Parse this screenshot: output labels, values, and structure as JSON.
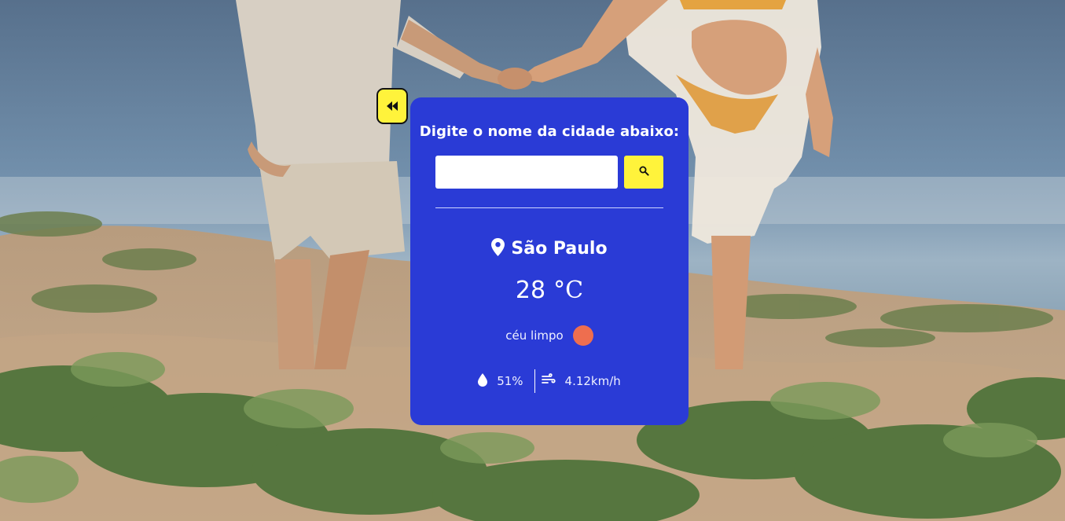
{
  "background": {
    "sky": "#6e8aa6",
    "sand": "#c9a987",
    "plants": "#5f7d45"
  },
  "nav": {
    "back_icon": "rewind-icon",
    "accent": "#fff33b"
  },
  "card": {
    "background": "#2a3bd6",
    "title": "Digite o nome da cidade abaixo:",
    "search": {
      "value": "",
      "placeholder": "",
      "button_icon": "search-icon"
    }
  },
  "weather": {
    "location_icon": "map-pin-icon",
    "city": "São Paulo",
    "temperature": "28",
    "unit": "°C",
    "description": "céu limpo",
    "condition_icon": "sun-icon",
    "condition_color": "#ee6e4f",
    "humidity_icon": "droplet-icon",
    "humidity": "51%",
    "wind_icon": "wind-icon",
    "wind": "4.12km/h"
  }
}
